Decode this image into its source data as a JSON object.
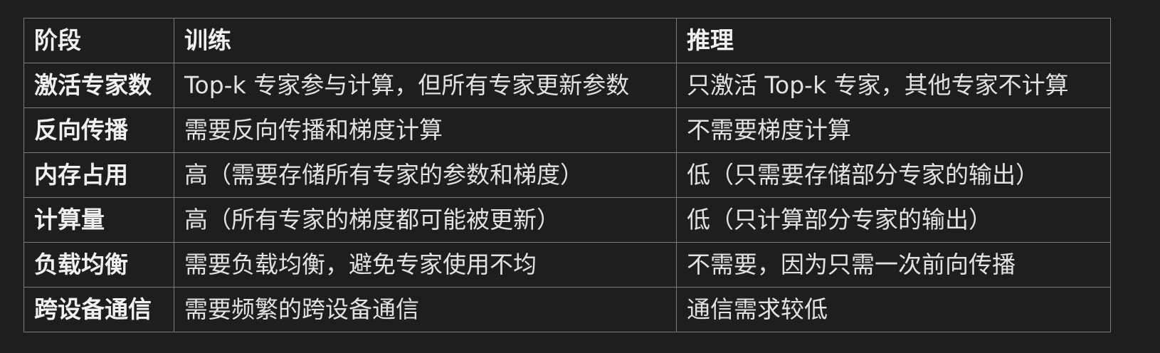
{
  "table": {
    "headers": [
      "阶段",
      "训练",
      "推理"
    ],
    "rows": [
      [
        "激活专家数",
        "Top-k 专家参与计算，但所有专家更新参数",
        "只激活 Top-k 专家，其他专家不计算"
      ],
      [
        "反向传播",
        "需要反向传播和梯度计算",
        "不需要梯度计算"
      ],
      [
        "内存占用",
        "高（需要存储所有专家的参数和梯度）",
        "低（只需要存储部分专家的输出）"
      ],
      [
        "计算量",
        "高（所有专家的梯度都可能被更新）",
        "低（只计算部分专家的输出）"
      ],
      [
        "负载均衡",
        "需要负载均衡，避免专家使用不均",
        "不需要，因为只需一次前向传播"
      ],
      [
        "跨设备通信",
        "需要频繁的跨设备通信",
        "通信需求较低"
      ]
    ]
  }
}
